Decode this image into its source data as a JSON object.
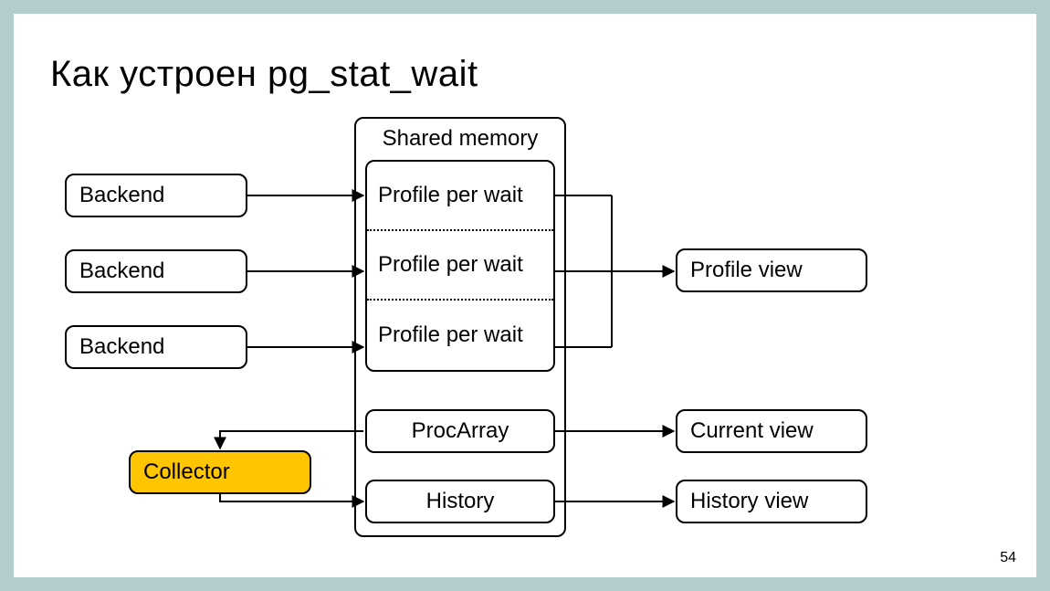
{
  "title": "Как устроен pg_stat_wait",
  "page_number": "54",
  "backends": [
    "Backend",
    "Backend",
    "Backend"
  ],
  "shared_memory": {
    "label": "Shared memory",
    "profiles": [
      "Profile per wait",
      "Profile per wait",
      "Profile per wait"
    ],
    "procarray": "ProcArray",
    "history": "History"
  },
  "collector": "Collector",
  "views": {
    "profile": "Profile view",
    "current": "Current view",
    "history": "History view"
  },
  "colors": {
    "collector_bg": "#ffc600",
    "page_bg": "#b3cccc"
  }
}
